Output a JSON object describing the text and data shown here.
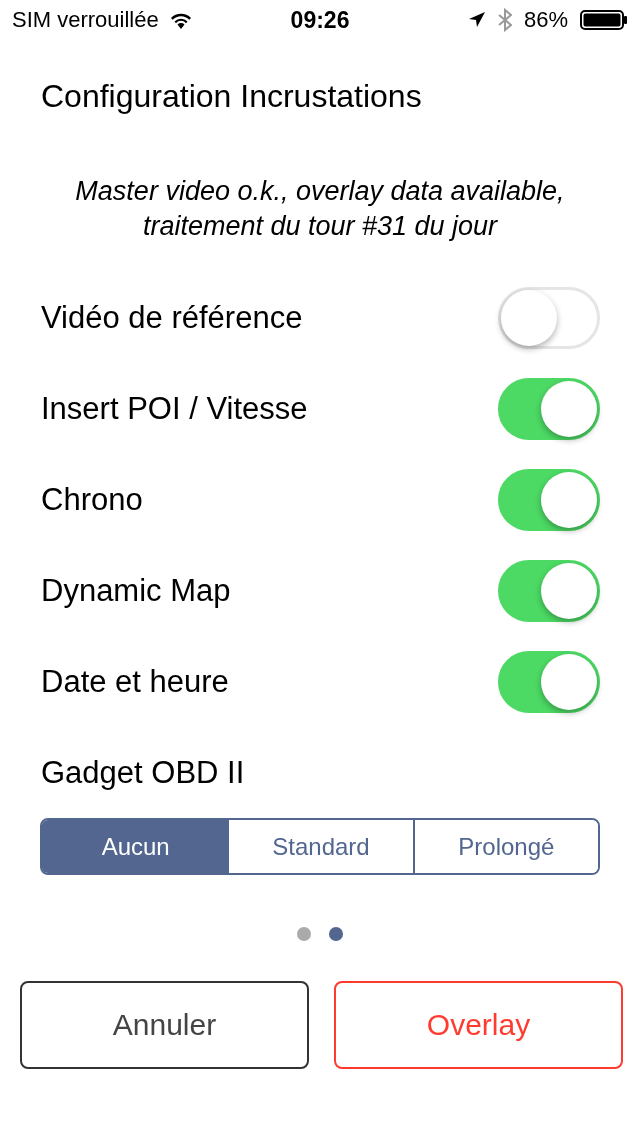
{
  "status_bar": {
    "carrier": "SIM verrouillée",
    "time": "09:26",
    "battery": "86%"
  },
  "title": "Configuration Incrustations",
  "message": "Master video o.k., overlay data available, traitement du tour #31 du jour",
  "settings": [
    {
      "label": "Vidéo de référence",
      "on": false
    },
    {
      "label": "Insert POI / Vitesse",
      "on": true
    },
    {
      "label": "Chrono",
      "on": true
    },
    {
      "label": "Dynamic Map",
      "on": true
    },
    {
      "label": "Date et heure",
      "on": true
    }
  ],
  "gadget": {
    "label": "Gadget OBD II",
    "options": [
      {
        "label": "Aucun",
        "selected": true
      },
      {
        "label": "Standard",
        "selected": false
      },
      {
        "label": "Prolongé",
        "selected": false
      }
    ]
  },
  "page_dots": [
    {
      "selected": false
    },
    {
      "selected": true
    }
  ],
  "buttons": [
    {
      "label": "Annuler",
      "kind": "cancel"
    },
    {
      "label": "Overlay",
      "kind": "primary"
    }
  ]
}
